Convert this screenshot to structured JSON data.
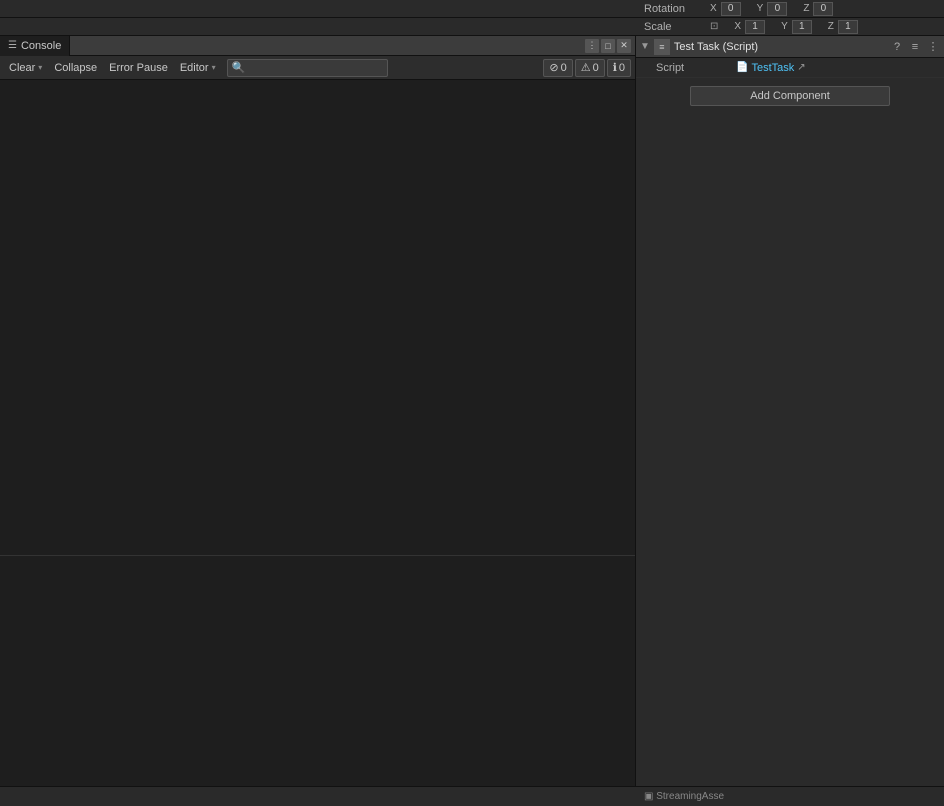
{
  "rotation_bar": {
    "rotation_label": "Rotation",
    "scale_label": "Scale",
    "x_label": "X",
    "y_label": "Y",
    "z_label": "Z",
    "rotation_x": "0",
    "rotation_y": "0",
    "rotation_z": "0",
    "scale_x": "1",
    "scale_y": "1",
    "scale_z": "1",
    "scale_icon": "⊡"
  },
  "console": {
    "tab_label": "Console",
    "tab_icon": "☰",
    "clear_label": "Clear",
    "clear_chevron": "▾",
    "collapse_label": "Collapse",
    "error_pause_label": "Error Pause",
    "editor_label": "Editor",
    "editor_chevron": "▾",
    "search_placeholder": "",
    "count_errors": "0",
    "count_warnings": "0",
    "count_info": "0",
    "error_icon": "⊘",
    "warning_icon": "⚠",
    "info_icon": "ℹ",
    "tab_dots_icon": "⋮",
    "tab_maximize_icon": "□",
    "tab_close_icon": "✕"
  },
  "inspector": {
    "component_title": "Test Task (Script)",
    "component_icon": "≡",
    "help_icon": "?",
    "settings_icon": "≡",
    "more_icon": "⋮",
    "script_label": "Script",
    "script_file_icon": "📄",
    "script_value": "TestTask",
    "open_icon": "↗",
    "add_component_label": "Add Component"
  },
  "status_bar": {
    "streaming_assets_text": "▣ StreamingAsse"
  }
}
